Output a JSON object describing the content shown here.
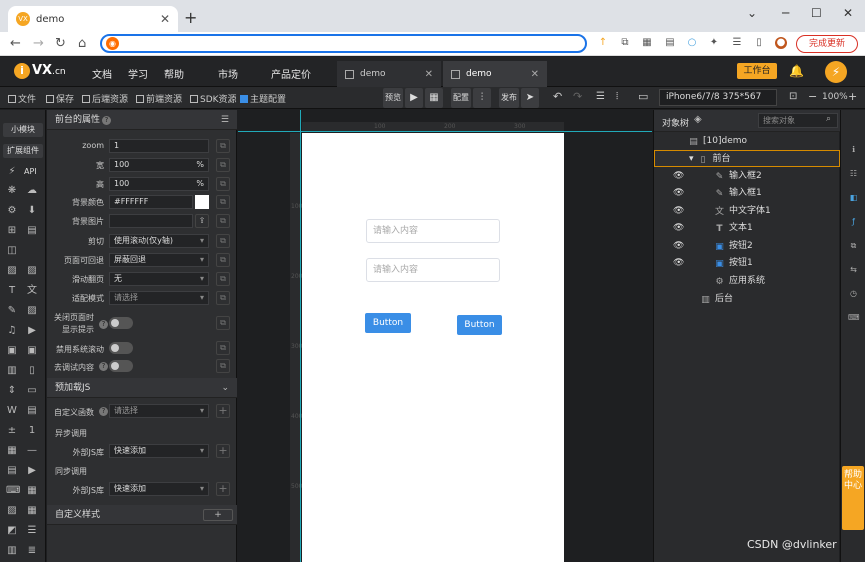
{
  "browser": {
    "tab_title": "demo",
    "tab_icon": "VX",
    "new_tab": "+",
    "minimize": "─",
    "maximize": "☐",
    "close": "✕",
    "back": "←",
    "forward": "→",
    "reload": "↻",
    "home": "⌂",
    "address": "",
    "update_button": "完成更新",
    "colors": {
      "address_border": "#1a73e8",
      "update": "#d93025"
    }
  },
  "topnav": {
    "logo": "VX",
    "logo_suffix": ".cn",
    "logo_i": "i",
    "menu": [
      "文档",
      "学习",
      "帮助",
      "市场",
      "产品定价"
    ],
    "tabs": [
      {
        "label": "demo",
        "close": "✕"
      },
      {
        "label": "demo",
        "close": "✕"
      }
    ],
    "workbench": "工作台",
    "bell": "🔔",
    "avatar": "⚡",
    "accent": "#f5a623"
  },
  "toolbar": {
    "file": "文件",
    "save": "保存",
    "backend": "后端资源",
    "frontend": "前端资源",
    "sdk": "SDK资源",
    "theme": "主题配置",
    "preview": "预览",
    "config": "配置",
    "publish": "发布",
    "device": "iPhone6/7/8 375*567",
    "zoom": "100%",
    "zoom_minus": "−",
    "zoom_plus": "+"
  },
  "leftstrip": {
    "small_module": "小模块",
    "extension": "扩展组件",
    "api": "API"
  },
  "props": {
    "header": "前台的属性",
    "rows": {
      "zoom": {
        "label": "zoom",
        "value": "1"
      },
      "width": {
        "label": "宽",
        "value": "100",
        "unit": "%"
      },
      "height": {
        "label": "高",
        "value": "100",
        "unit": "%"
      },
      "bgcolor": {
        "label": "背景颜色",
        "value": "#FFFFFF"
      },
      "bgimage": {
        "label": "背景图片",
        "value": ""
      },
      "clip": {
        "label": "剪切",
        "value": "使用滚动(仅y轴)"
      },
      "back": {
        "label": "页面可回退",
        "value": "屏蔽回退"
      },
      "swipe": {
        "label": "滑动翻页",
        "value": "无"
      },
      "fit": {
        "label": "适配模式",
        "value": "请选择"
      }
    },
    "close_tip_label_1": "关闭页面时",
    "close_tip_label_2": "显示提示",
    "disable_scroll": "禁用系统滚动",
    "remove_debug": "去调试内容",
    "preload_header": "预加载JS",
    "custom_func": {
      "label": "自定义函数",
      "value": "请选择"
    },
    "async_call": "异步调用",
    "ext_js_1": {
      "label": "外部JS库",
      "value": "快速添加"
    },
    "sync_call": "同步调用",
    "ext_js_2": {
      "label": "外部JS库",
      "value": "快速添加"
    },
    "custom_style": "自定义样式",
    "add": "+"
  },
  "ruler": {
    "h": [
      "100",
      "200",
      "300"
    ],
    "v": [
      "100",
      "200",
      "300",
      "400",
      "500"
    ]
  },
  "phone": {
    "input1_placeholder": "请输入内容",
    "input2_placeholder": "请输入内容",
    "button1": "Button",
    "button2": "Button",
    "button_color": "#3a8ee6"
  },
  "tree": {
    "title": "对象树",
    "search_placeholder": "搜索对象",
    "root": "[10]demo",
    "front": "前台",
    "items": [
      "输入框2",
      "输入框1",
      "中文字体1",
      "文本1",
      "按钮2",
      "按钮1"
    ],
    "app_system": "应用系统",
    "back": "后台",
    "eye": "👁"
  },
  "help_float": "帮助中心",
  "watermark": "CSDN @dvlinker"
}
